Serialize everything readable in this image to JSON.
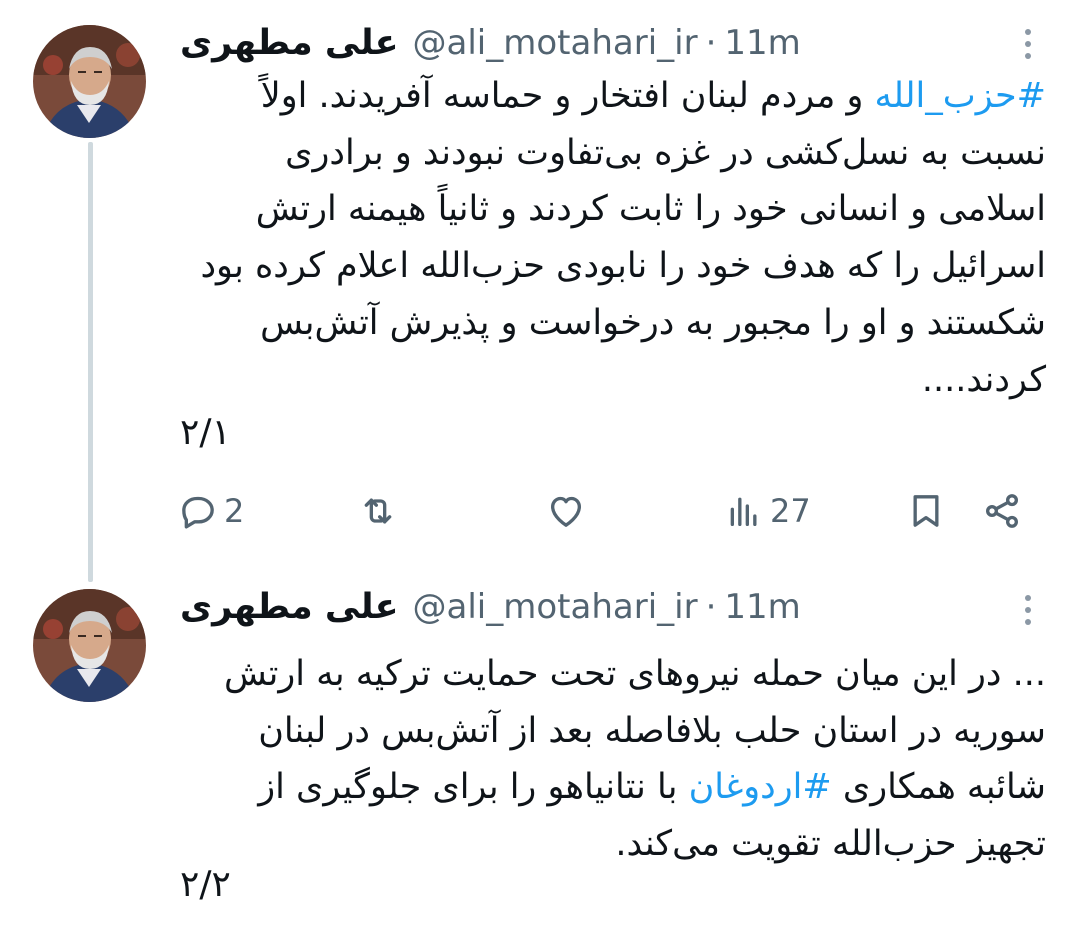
{
  "tweets": [
    {
      "author_name": "علی مطهری",
      "handle": "@ali_motahari_ir",
      "separator": "·",
      "time": "11m",
      "hashtag": "#حزب_الله",
      "text_after_hashtag": " و مردم لبنان افتخار و حماسه آفریدند. اولاً نسبت به نسل‌کشی در غزه بی‌تفاوت نبودند و برادری اسلامی و انسانی خود را ثابت کردند و ثانیاً هیمنه ارتش اسرائیل را که هدف خود را نابودی حزب‌الله اعلام کرده بود شکستند و او را مجبور به درخواست و پذیرش آتش‌بس کردند....",
      "thread_index": "۲/۱",
      "replies": "2",
      "views": "27"
    },
    {
      "author_name": "علی مطهری",
      "handle": "@ali_motahari_ir",
      "separator": "·",
      "time": "11m",
      "text_before_hashtag": "... در این میان حمله نیروهای تحت حمایت ترکیه به ارتش سوریه در استان حلب بلافاصله بعد از آتش‌بس در لبنان شائبه همکاری ",
      "hashtag": "#اردوغان",
      "text_after_hashtag": " با نتانیاهو را برای جلوگیری از تجهیز حزب‌الله تقویت می‌کند.",
      "thread_index": "۲/۲"
    }
  ],
  "colors": {
    "text": "#0f1419",
    "secondary": "#536471",
    "link": "#1d9bf0",
    "thread_line": "#cfd9de"
  },
  "icons": {
    "more": "more-vertical-icon",
    "reply": "reply-bubble-icon",
    "retweet": "retweet-icon",
    "like": "heart-icon",
    "views": "analytics-bars-icon",
    "bookmark": "bookmark-icon",
    "share": "share-icon"
  }
}
